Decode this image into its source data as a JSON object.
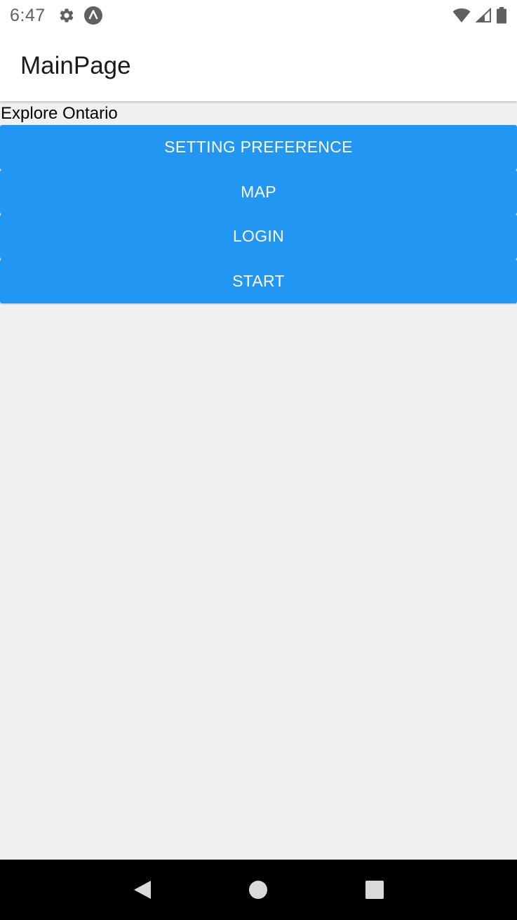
{
  "status_bar": {
    "time": "6:47",
    "left_icons": [
      "gear-icon",
      "app-notification-icon"
    ],
    "right_icons": [
      "wifi-icon",
      "signal-icon",
      "battery-icon"
    ]
  },
  "app_bar": {
    "title": "MainPage"
  },
  "content": {
    "label": "Explore Ontario",
    "buttons": [
      {
        "label": "SETTING PREFERENCE"
      },
      {
        "label": "MAP"
      },
      {
        "label": "LOGIN"
      },
      {
        "label": "START"
      }
    ]
  },
  "nav_bar": {
    "icons": [
      "back-icon",
      "home-icon",
      "recents-icon"
    ]
  },
  "colors": {
    "button": "#2196f3",
    "background": "#f0f0f0",
    "app_bar": "#ffffff",
    "nav_bar": "#000000"
  }
}
